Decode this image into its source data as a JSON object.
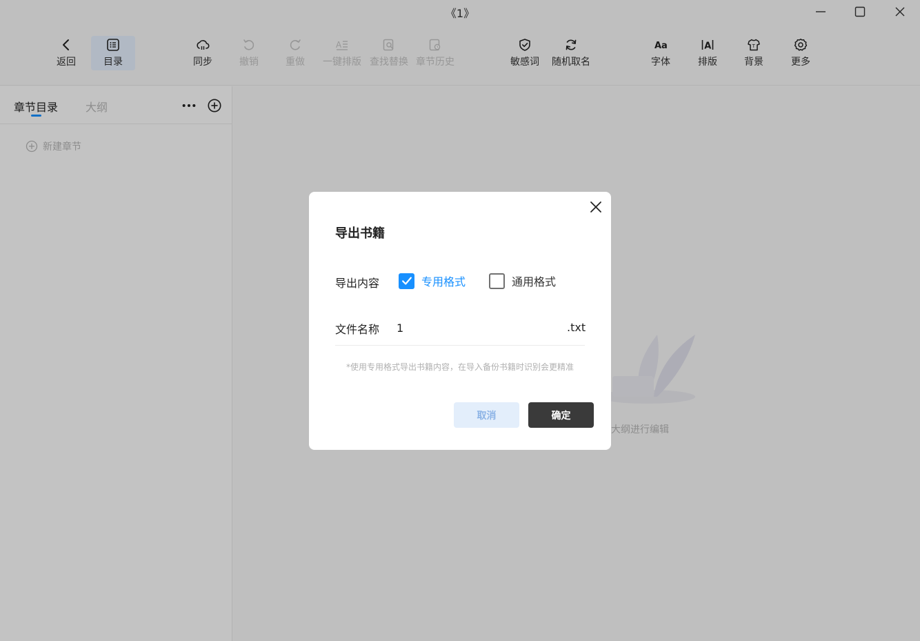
{
  "window": {
    "title": "《1》"
  },
  "toolbar": {
    "back": "返回",
    "toc": "目录",
    "sync": "同步",
    "undo": "撤销",
    "redo": "重做",
    "auto_format": "一键排版",
    "find_replace": "查找替换",
    "chapter_history": "章节历史",
    "sensitive_words": "敏感词",
    "random_name": "随机取名",
    "font": "字体",
    "layout": "排版",
    "background": "背景",
    "more": "更多"
  },
  "sidebar": {
    "tabs": [
      {
        "label": "章节目录",
        "active": true
      },
      {
        "label": "大纲",
        "active": false
      }
    ],
    "new_chapter": "新建章节"
  },
  "main": {
    "empty_text": "大纲进行编辑"
  },
  "dialog": {
    "title": "导出书籍",
    "content_label": "导出内容",
    "options": [
      {
        "label": "专用格式",
        "checked": true
      },
      {
        "label": "通用格式",
        "checked": false
      }
    ],
    "filename_label": "文件名称",
    "filename_value": "1",
    "extension": ".txt",
    "hint": "*使用专用格式导出书籍内容，在导入备份书籍时识别会更精准",
    "cancel": "取消",
    "confirm": "确定"
  },
  "colors": {
    "accent": "#1890ff",
    "confirm_button": "#3a3a3a",
    "cancel_button": "#e3eefb"
  }
}
